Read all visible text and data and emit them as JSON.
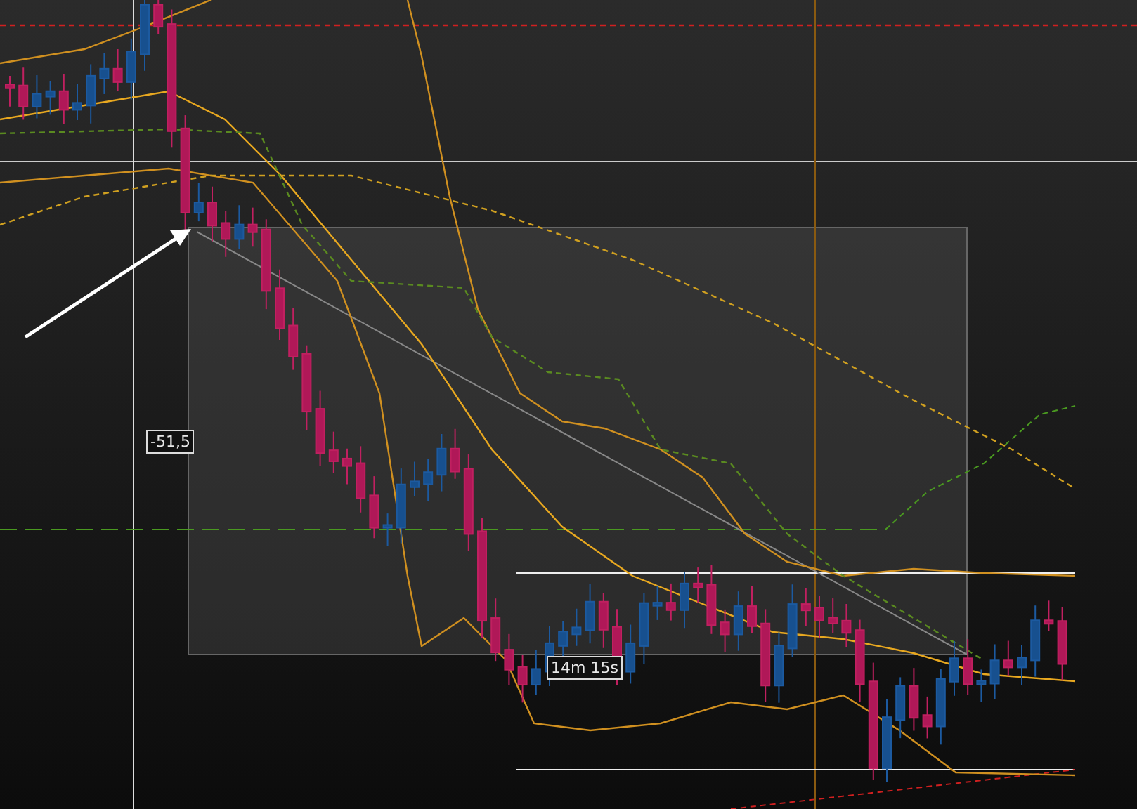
{
  "chart": {
    "measure": {
      "value": "-51,5",
      "duration": "14m 15s"
    }
  }
}
